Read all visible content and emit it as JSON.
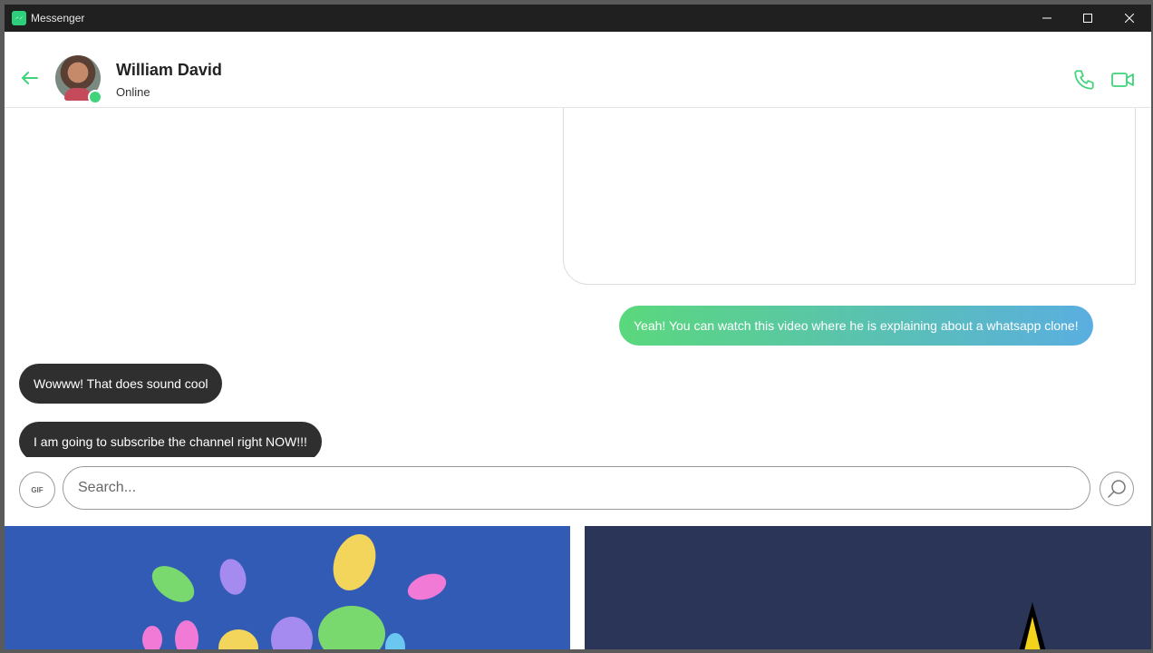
{
  "window": {
    "title": "Messenger",
    "icons": {
      "app": "messenger-icon",
      "minimize": "minimize-icon",
      "maximize": "maximize-icon",
      "close": "close-icon"
    }
  },
  "header": {
    "name": "William David",
    "status": "Online",
    "icons": {
      "back": "arrow-left-icon",
      "call": "phone-icon",
      "video": "video-camera-icon"
    }
  },
  "messages": [
    {
      "from": "me",
      "text": "Yeah! You can watch this video where he is explaining about a whatsapp clone!"
    },
    {
      "from": "contact",
      "text": "Wowww! That does sound cool"
    },
    {
      "from": "contact",
      "text": "I am going to subscribe the channel right NOW!!!"
    }
  ],
  "composer": {
    "gif_label": "GIF",
    "search_placeholder": "Search...",
    "icons": {
      "search": "search-icon"
    }
  },
  "colors": {
    "accent": "#3fd37a",
    "bubble_out_start": "#5ad87c",
    "bubble_out_end": "#5aaee0",
    "bubble_in": "#2f2f2f",
    "titlebar": "#202020"
  }
}
